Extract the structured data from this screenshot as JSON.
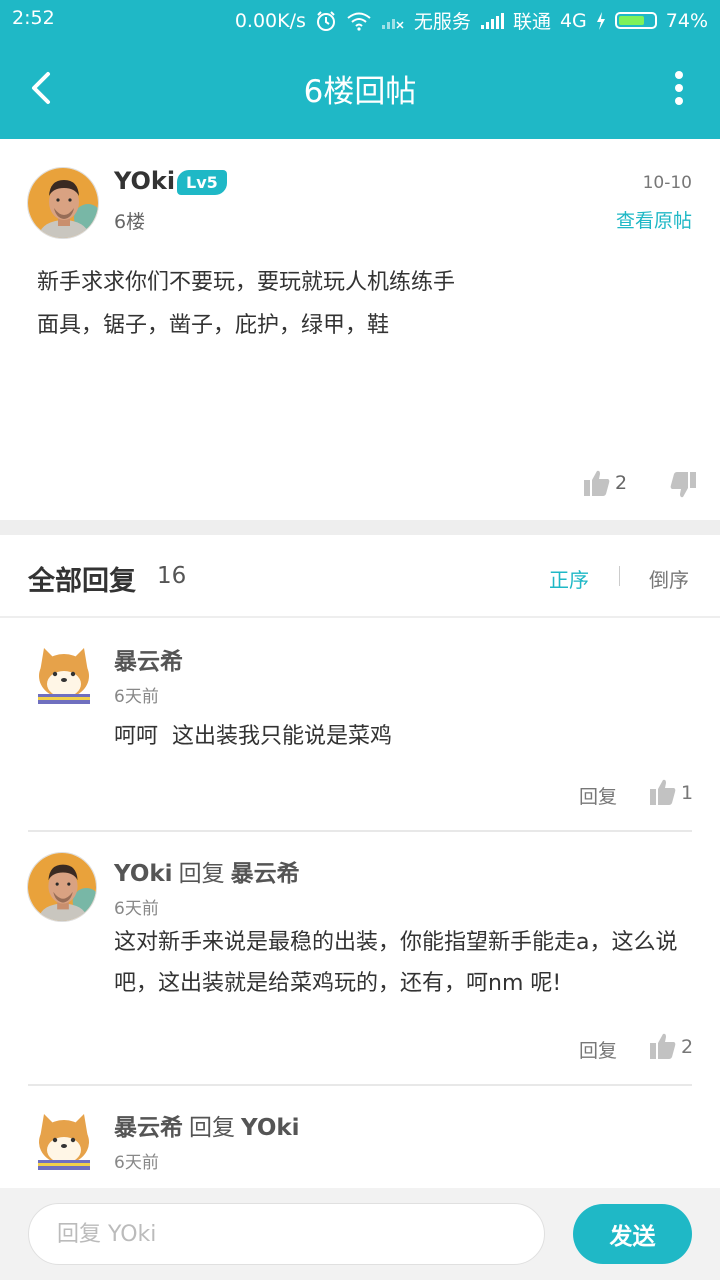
{
  "status_bar": {
    "time": "2:52",
    "net_speed": "0.00K/s",
    "sim1": "无服务",
    "carrier": "联通",
    "network": "4G",
    "battery_percent": "74%",
    "battery_level": 0.74
  },
  "appbar": {
    "title": "6楼回帖",
    "back_icon": "back-arrow-icon",
    "more_icon": "more-vert-icon"
  },
  "post": {
    "author": "YOki",
    "level": "Lv5",
    "floor": "6楼",
    "date": "10-10",
    "view_original": "查看原帖",
    "content": "新手求求你们不要玩，要玩就玩人机练练手\n面具，锯子，凿子，庇护，绿甲，鞋",
    "like_count": "2"
  },
  "replies": {
    "title": "全部回复",
    "count": "16",
    "sort_asc": "正序",
    "sort_desc": "倒序",
    "items": [
      {
        "user": "暴云希",
        "verb": "",
        "target": "",
        "time": "6天前",
        "text": "呵呵  这出装我只能说是菜鸡",
        "reply_label": "回复",
        "likes": "1"
      },
      {
        "user": "YOki",
        "verb": "回复",
        "target": "暴云希",
        "time": "6天前",
        "text": "这对新手来说是最稳的出装，你能指望新手能走a，这么说吧，这出装就是给菜鸡玩的，还有，呵nm 呢!",
        "reply_label": "回复",
        "likes": "2"
      },
      {
        "user": "暴云希",
        "verb": "回复",
        "target": "YOki",
        "time": "6天前"
      }
    ]
  },
  "composer": {
    "placeholder": "回复 YOki",
    "send_label": "发送"
  },
  "colors": {
    "accent": "#1fb8c6",
    "background_band": "#eeeeee"
  }
}
